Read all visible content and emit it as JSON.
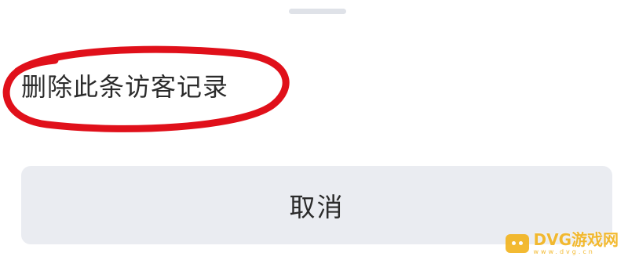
{
  "sheet": {
    "option_label": "删除此条访客记录",
    "cancel_label": "取消"
  },
  "annotation": {
    "shape": "hand-drawn ellipse",
    "color": "#e0101a"
  },
  "watermark": {
    "brand": "DVG游戏网",
    "subtext": "www.dvg.cn",
    "color": "#f2b31c"
  }
}
